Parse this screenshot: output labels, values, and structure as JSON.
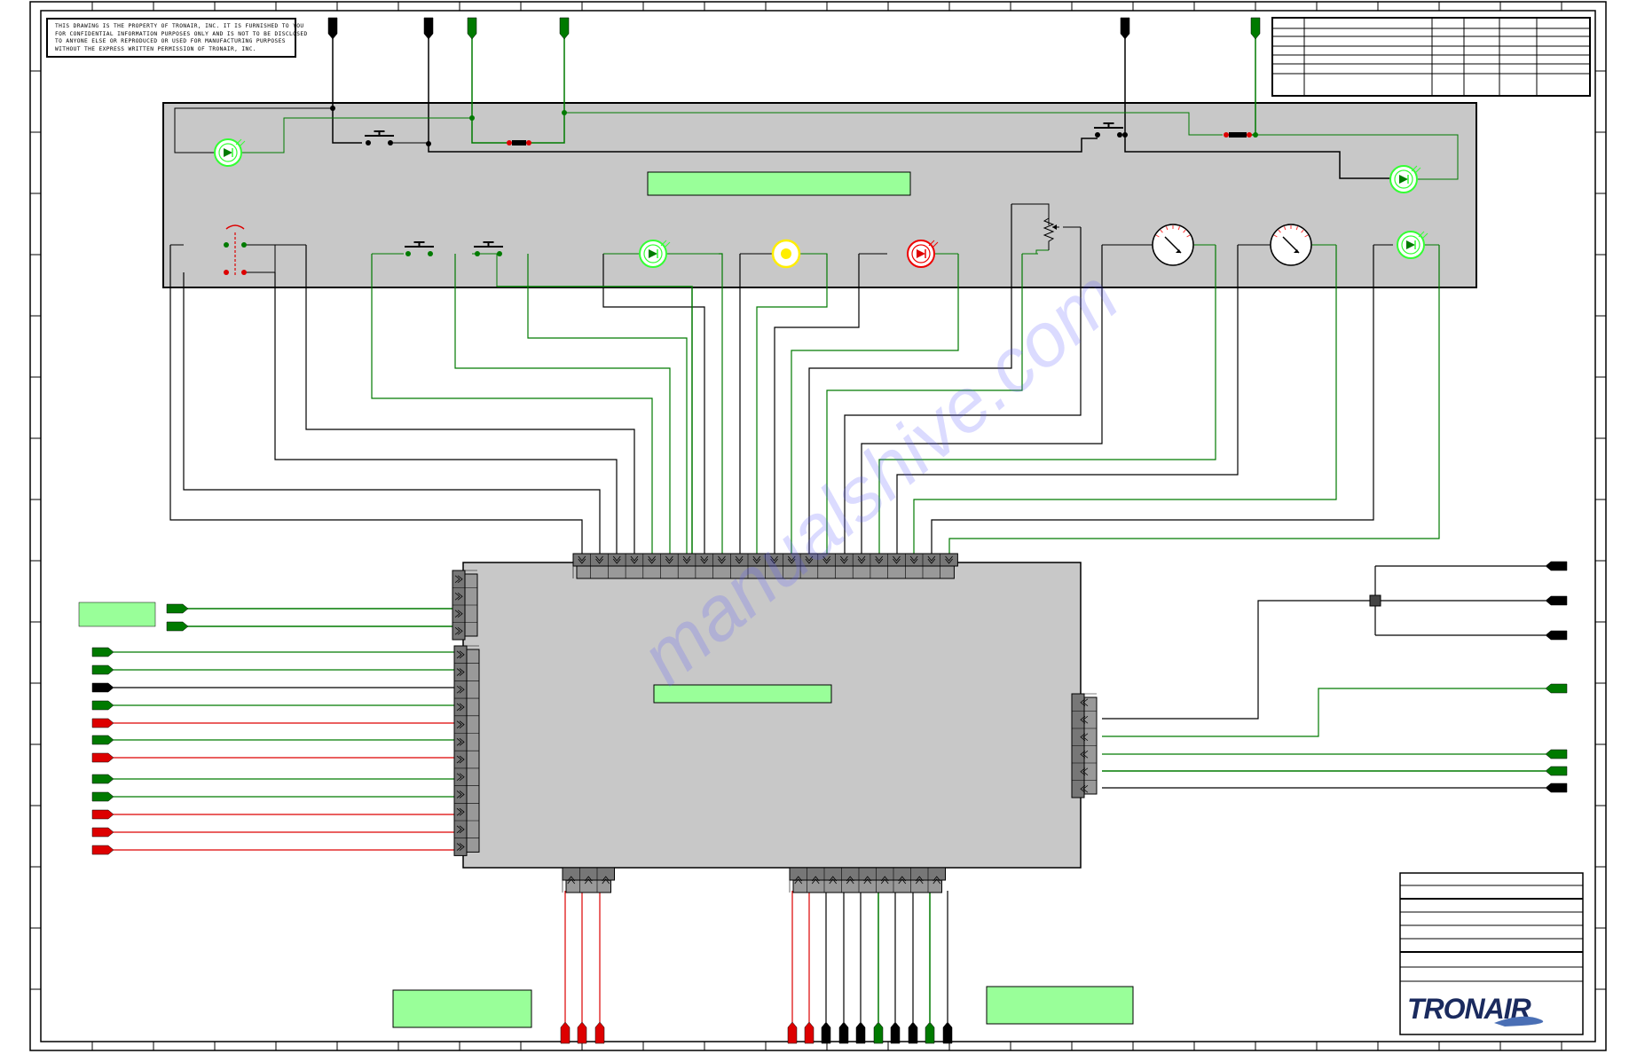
{
  "drawing": {
    "notice_lines": [
      "THIS DRAWING IS THE PROPERTY OF TRONAIR, INC.  IT IS FURNISHED TO YOU",
      "FOR CONFIDENTIAL INFORMATION PURPOSES ONLY AND IS NOT TO BE DISCLOSED",
      "TO ANYONE ELSE OR REPRODUCED OR USED FOR MANUFACTURING PURPOSES",
      "WITHOUT THE EXPRESS WRITTEN PERMISSION OF TRONAIR, INC."
    ],
    "brand_logo": "TRONAIR",
    "colors": {
      "panel": "#c8c8c8",
      "label_fill": "#99ff99",
      "wire_green": "#007a00",
      "wire_black": "#000000",
      "wire_red": "#dd0000",
      "led_green": "#33ff33",
      "led_yellow": "#ffee00",
      "led_red": "#ee0000"
    }
  }
}
